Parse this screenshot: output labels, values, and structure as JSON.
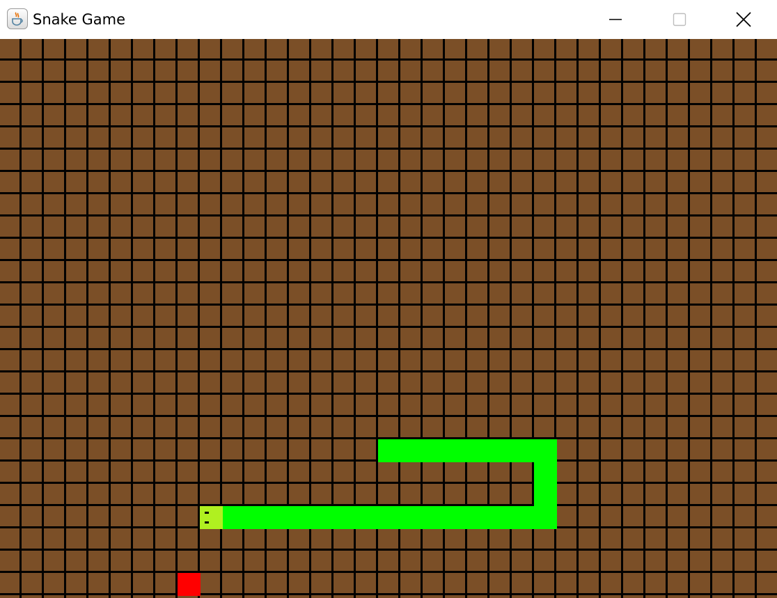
{
  "window": {
    "title": "Snake Game",
    "icon": "java-coffee-cup-icon",
    "controls": {
      "minimize_icon": "minimize-icon",
      "maximize_icon": "maximize-icon",
      "close_icon": "close-icon"
    }
  },
  "game": {
    "grid": {
      "columns": 35,
      "rows": 26
    },
    "colors": {
      "ground": "#7b4f27",
      "grid_lines": "#000000",
      "snake_body": "#00ff00",
      "snake_head": "#b0f020",
      "snake_eyes": "#000000",
      "food": "#ff0000"
    },
    "snake": {
      "head": {
        "col": 9,
        "row": 21
      },
      "direction": "left",
      "body": [
        {
          "col": 10,
          "row": 21
        },
        {
          "col": 11,
          "row": 21
        },
        {
          "col": 12,
          "row": 21
        },
        {
          "col": 13,
          "row": 21
        },
        {
          "col": 14,
          "row": 21
        },
        {
          "col": 15,
          "row": 21
        },
        {
          "col": 16,
          "row": 21
        },
        {
          "col": 17,
          "row": 21
        },
        {
          "col": 18,
          "row": 21
        },
        {
          "col": 19,
          "row": 21
        },
        {
          "col": 20,
          "row": 21
        },
        {
          "col": 21,
          "row": 21
        },
        {
          "col": 22,
          "row": 21
        },
        {
          "col": 23,
          "row": 21
        },
        {
          "col": 24,
          "row": 21
        },
        {
          "col": 24,
          "row": 20
        },
        {
          "col": 24,
          "row": 19
        },
        {
          "col": 24,
          "row": 18
        },
        {
          "col": 23,
          "row": 18
        },
        {
          "col": 22,
          "row": 18
        },
        {
          "col": 21,
          "row": 18
        },
        {
          "col": 20,
          "row": 18
        },
        {
          "col": 19,
          "row": 18
        },
        {
          "col": 18,
          "row": 18
        },
        {
          "col": 17,
          "row": 18
        }
      ]
    },
    "food": {
      "col": 8,
      "row": 24
    }
  }
}
